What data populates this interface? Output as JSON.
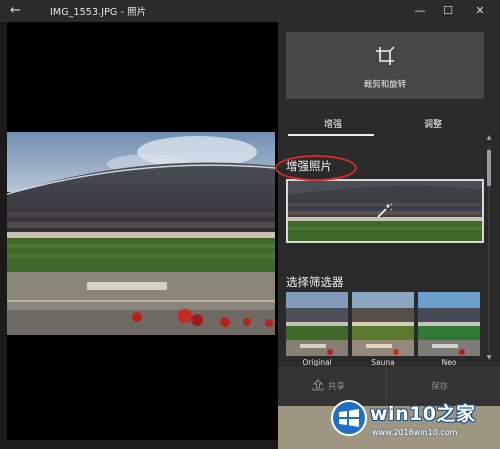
{
  "titlebar": {
    "back_icon": "←",
    "title": "IMG_1553.JPG - 照片",
    "minimize": "—",
    "maximize": "☐",
    "close": "✕"
  },
  "panel": {
    "crop_label": "裁剪和旋转",
    "tabs": [
      {
        "label": "增强",
        "active": true
      },
      {
        "label": "调整",
        "active": false
      }
    ],
    "enhance_label": "增强照片",
    "filter_label": "选择筛选器",
    "filters": [
      {
        "label": "Original"
      },
      {
        "label": "Sauna"
      },
      {
        "label": "Neo"
      }
    ],
    "share_label": "共享",
    "save_label": "保存"
  },
  "watermark": {
    "title": "win10之家",
    "url": "www.2016win10.com"
  },
  "colors": {
    "annotation": "#d42a2a",
    "panel": "#2a2a2a",
    "crop_button": "#474747"
  }
}
